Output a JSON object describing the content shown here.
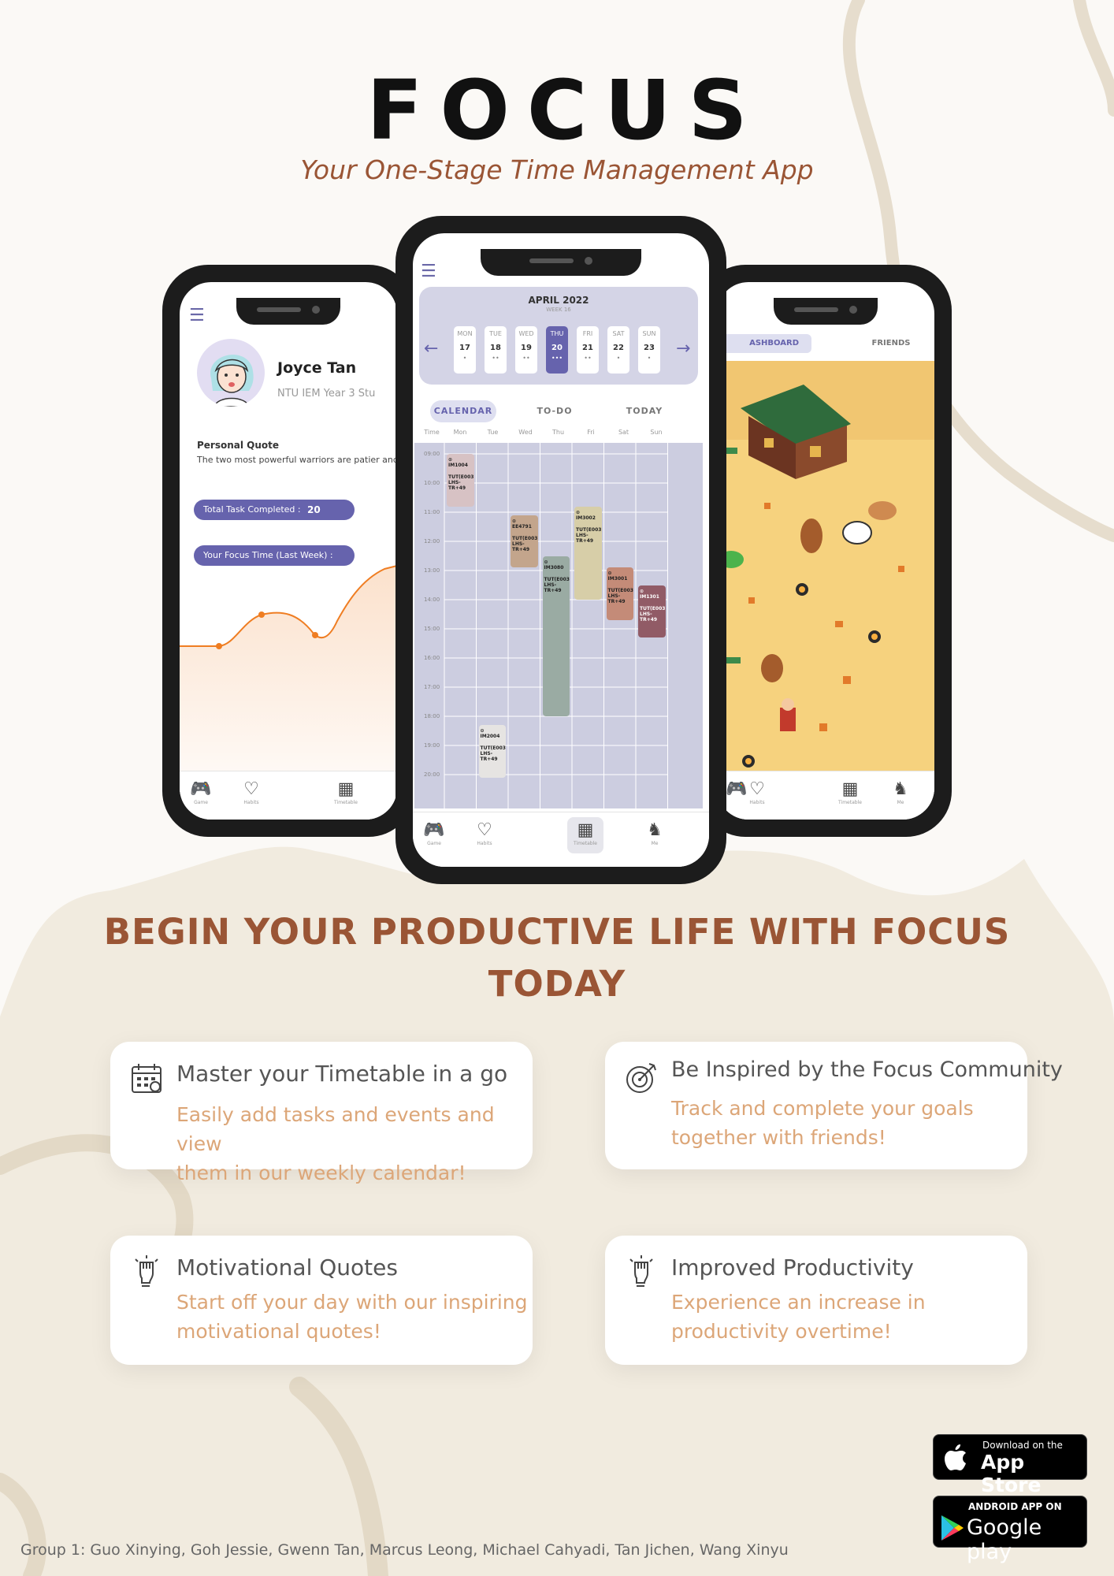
{
  "header": {
    "title": "FOCUS",
    "subtitle": "Your One-Stage Time Management App"
  },
  "left_phone": {
    "user_name": "Joyce Tan",
    "user_desc": "NTU IEM Year 3 Stu",
    "quote_label": "Personal Quote",
    "quote_text": "The two most powerful warriors are patier and time.",
    "tasks_label": "Total Task Completed :",
    "tasks_value": "20",
    "focus_label": "Your Focus Time (Last Week) :",
    "tabs": [
      "Game",
      "Habits",
      "Timetable"
    ]
  },
  "center_phone": {
    "month": "APRIL 2022",
    "week": "WEEK 16",
    "days": [
      {
        "name": "MON",
        "date": "17",
        "dots": "•"
      },
      {
        "name": "TUE",
        "date": "18",
        "dots": "••"
      },
      {
        "name": "WED",
        "date": "19",
        "dots": "••"
      },
      {
        "name": "THU",
        "date": "20",
        "dots": "•••"
      },
      {
        "name": "FRI",
        "date": "21",
        "dots": "••"
      },
      {
        "name": "SAT",
        "date": "22",
        "dots": "•"
      },
      {
        "name": "SUN",
        "date": "23",
        "dots": "•"
      }
    ],
    "selected_day": 3,
    "view_tabs": [
      "CALENDAR",
      "TO-DO",
      "TODAY"
    ],
    "columns": [
      "Time",
      "Mon",
      "Tue",
      "Wed",
      "Thu",
      "Fri",
      "Sat",
      "Sun"
    ],
    "times": [
      "09:00",
      "10:00",
      "11:00",
      "12:00",
      "13:00",
      "14:00",
      "15:00",
      "16:00",
      "17:00",
      "18:00",
      "19:00",
      "20:00"
    ],
    "events": [
      {
        "code": "IM1004",
        "sub": "TUT(E003) LHS-TR+49",
        "day": 0,
        "start": 9.0,
        "end": 10.8,
        "color": "#d7c2c4"
      },
      {
        "code": "EE4791",
        "sub": "TUT(E003) LHS-TR+49",
        "day": 2,
        "start": 11.1,
        "end": 12.9,
        "color": "#c3a58c"
      },
      {
        "code": "IM3002",
        "sub": "TUT(E003) LHS-TR+49",
        "day": 4,
        "start": 10.8,
        "end": 14.0,
        "color": "#d7cea8"
      },
      {
        "code": "IM3080",
        "sub": "TUT(E003) LHS-TR+49",
        "day": 3,
        "start": 12.5,
        "end": 18.0,
        "color": "#9aaba3"
      },
      {
        "code": "IM3001",
        "sub": "TUT(E003) LHS-TR+49",
        "day": 5,
        "start": 12.9,
        "end": 14.7,
        "color": "#c48b78"
      },
      {
        "code": "IM1301",
        "sub": "TUT(E003) LHS-TR+49",
        "day": 6,
        "start": 13.5,
        "end": 15.3,
        "color": "#915b66"
      },
      {
        "code": "IM2004",
        "sub": "TUT(E003) LHS-TR+49",
        "day": 1,
        "start": 18.3,
        "end": 20.1,
        "color": "#e6e4e2"
      }
    ],
    "tabs": [
      "Game",
      "Habits",
      "Timetable",
      "Me"
    ]
  },
  "right_phone": {
    "tab_dashboard": "ASHBOARD",
    "tab_friends": "FRIENDS",
    "tabs": [
      "Habits",
      "Timetable",
      "Me"
    ]
  },
  "headline": [
    "BEGIN YOUR PRODUCTIVE LIFE WITH FOCUS",
    "TODAY"
  ],
  "features": [
    {
      "title": "Master your Timetable in a go",
      "desc": [
        "Easily add tasks and events and view",
        "them in our weekly calendar!"
      ],
      "icon": "calendar-icon"
    },
    {
      "title": "Be Inspired by the Focus Community",
      "desc": [
        "Track and complete your goals",
        "together with friends!"
      ],
      "icon": "target-icon"
    },
    {
      "title": "Motivational Quotes",
      "desc": [
        "Start off your day with our inspiring",
        "motivational quotes!"
      ],
      "icon": "raised-fist-icon"
    },
    {
      "title": "Improved Productivity",
      "desc": [
        "Experience an increase in",
        "productivity  overtime!"
      ],
      "icon": "raised-fist-icon"
    }
  ],
  "stores": {
    "apple_small": "Download on the",
    "apple_big": "App Store",
    "google_small": "ANDROID APP ON",
    "google_big": "Google play"
  },
  "footer": "Group 1: Guo Xinying, Goh Jessie, Gwenn Tan, Marcus Leong, Michael Cahyadi, Tan Jichen, Wang Xinyu",
  "colors": {
    "accent": "#6663ad",
    "brown": "#9a5535",
    "peach": "#dca678",
    "sand": "#f1ebdf"
  }
}
